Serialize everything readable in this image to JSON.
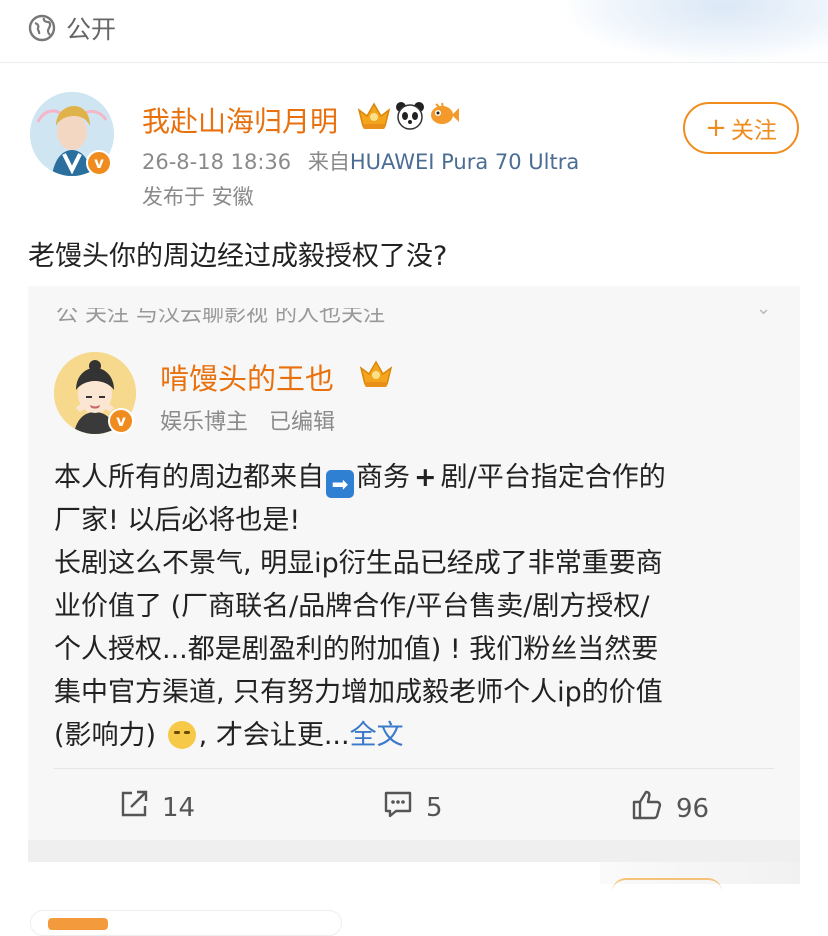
{
  "privacy": {
    "label": "公开"
  },
  "author": {
    "name": "我赴山海归月明",
    "timestamp": "26-8-18 18:36",
    "source_prefix": "来自",
    "device": "HUAWEI Pura 70 Ultra",
    "location": "发布于 安徽",
    "verified_mark": "v",
    "badges": [
      "crown-badge",
      "panda-badge",
      "orange-fish-badge"
    ]
  },
  "follow_button": {
    "plus": "+",
    "label": "关注"
  },
  "post": {
    "text": "老馒头你的周边经过成毅授权了没?"
  },
  "repost": {
    "partial_header": "公 关注 与汉云聊影视 的人也关注",
    "author": "啃馒头的王也",
    "verified_mark": "v",
    "meta": "娱乐博主   已编辑",
    "lines": [
      [
        "本人所有的周边都来自",
        "商务",
        "剧/平台指定合作的"
      ],
      "厂家! 以后必将也是!",
      "长剧这么不景气, 明显ip衍生品已经成了非常重要商",
      "业价值了 (厂商联名/品牌合作/平台售卖/剧方授权/",
      "个人授权...都是剧盈利的附加值) ! 我们粉丝当然要",
      "集中官方渠道, 只有努力增加成毅老师个人ip的价值",
      [
        "(影响力) ",
        ", 才会让更...",
        "全文"
      ]
    ],
    "arrow_emoji": "➡",
    "plus_emoji": "+"
  },
  "actions": {
    "repost_count": "14",
    "comment_count": "5",
    "like_count": "96"
  },
  "colors": {
    "accent_orange": "#e8710e",
    "link_blue": "#3b79c9",
    "device_blue": "#4b6c93"
  }
}
